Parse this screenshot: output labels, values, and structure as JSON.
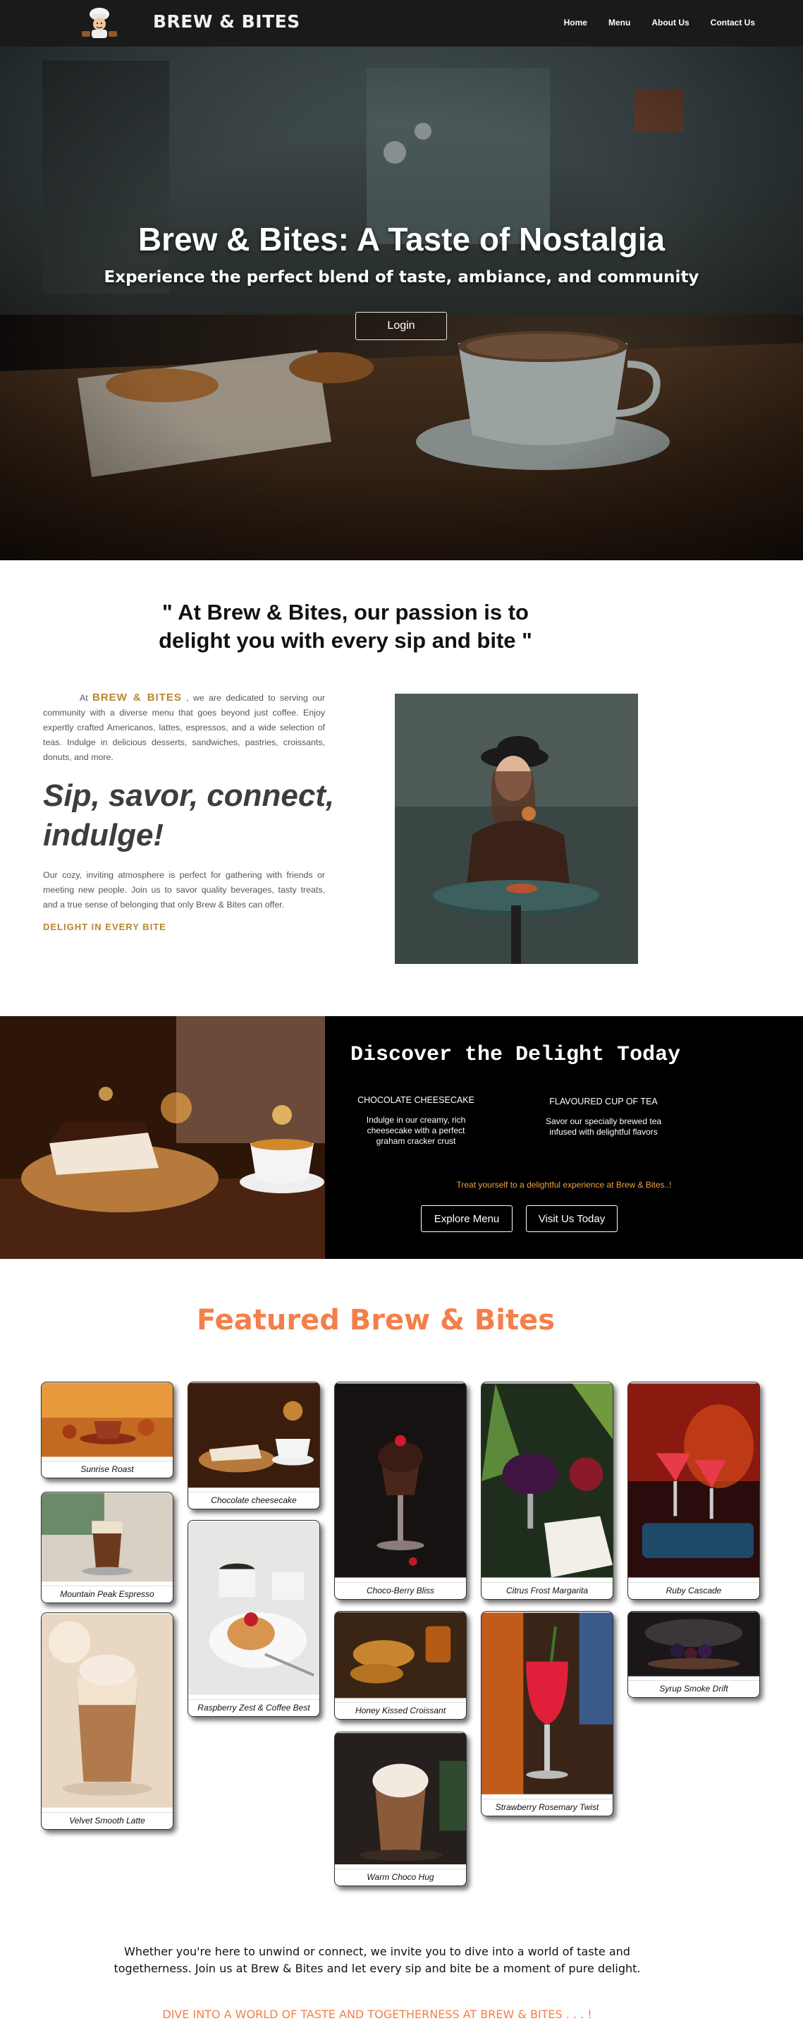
{
  "nav": {
    "brand": "BREW & BITES",
    "links": [
      "Home",
      "Menu",
      "About Us",
      "Contact Us"
    ]
  },
  "hero": {
    "title": "Brew & Bites: A Taste of Nostalgia",
    "subtitle": "Experience the perfect blend of taste, ambiance, and community",
    "login": "Login"
  },
  "about": {
    "quote": "\" At Brew & Bites, our passion is to delight you with every sip and bite \"",
    "intro_prefix": "At",
    "intro_brand": "BREW & BITES",
    "intro_text": ", we are dedicated to serving our community with a diverse menu that goes beyond just coffee. Enjoy expertly crafted Americanos, lattes, espressos, and a wide selection of teas. Indulge in delicious desserts, sandwiches, pastries, croissants, donuts, and more.",
    "slogan": "Sip, savor, connect, indulge!",
    "paragraph": "Our cozy, inviting atmosphere is perfect for gathering with friends or meeting new people. Join us to savor quality beverages, tasty treats, and a true sense of belonging that only Brew & Bites can offer.",
    "tagline": "DELIGHT IN EVERY BITE"
  },
  "discover": {
    "title": "Discover the Delight Today",
    "items": [
      {
        "heading": "CHOCOLATE CHEESECAKE",
        "desc": "Indulge in our creamy, rich cheesecake with a perfect graham cracker crust"
      },
      {
        "heading": "FLAVOURED CUP OF TEA",
        "desc": "Savor our specially brewed tea infused with delightful flavors"
      }
    ],
    "treat": "Treat yourself to a delightful experience at Brew & Bites..!",
    "buttons": [
      "Explore Menu",
      "Visit Us Today"
    ]
  },
  "featured": {
    "title": "Featured Brew & Bites",
    "items": [
      "Sunrise Roast",
      "Mountain Peak Espresso",
      "Velvet Smooth Latte",
      "Chocolate cheesecake",
      "Raspberry Zest & Coffee Best",
      "Choco-Berry Bliss",
      "Honey Kissed Croissant",
      "Warm Choco Hug",
      "Citrus Frost Margarita",
      "Strawberry Rosemary Twist",
      "Ruby Cascade",
      "Syrup Smoke Drift"
    ]
  },
  "closing": {
    "text": "Whether you're here to unwind or connect, we invite you to dive into a world of taste and togetherness. Join us at Brew & Bites and let every sip and bite be a moment of pure delight.",
    "dive": "DIVE INTO A WORLD OF TASTE AND TOGETHERNESS AT BREW & BITES . . . !"
  }
}
